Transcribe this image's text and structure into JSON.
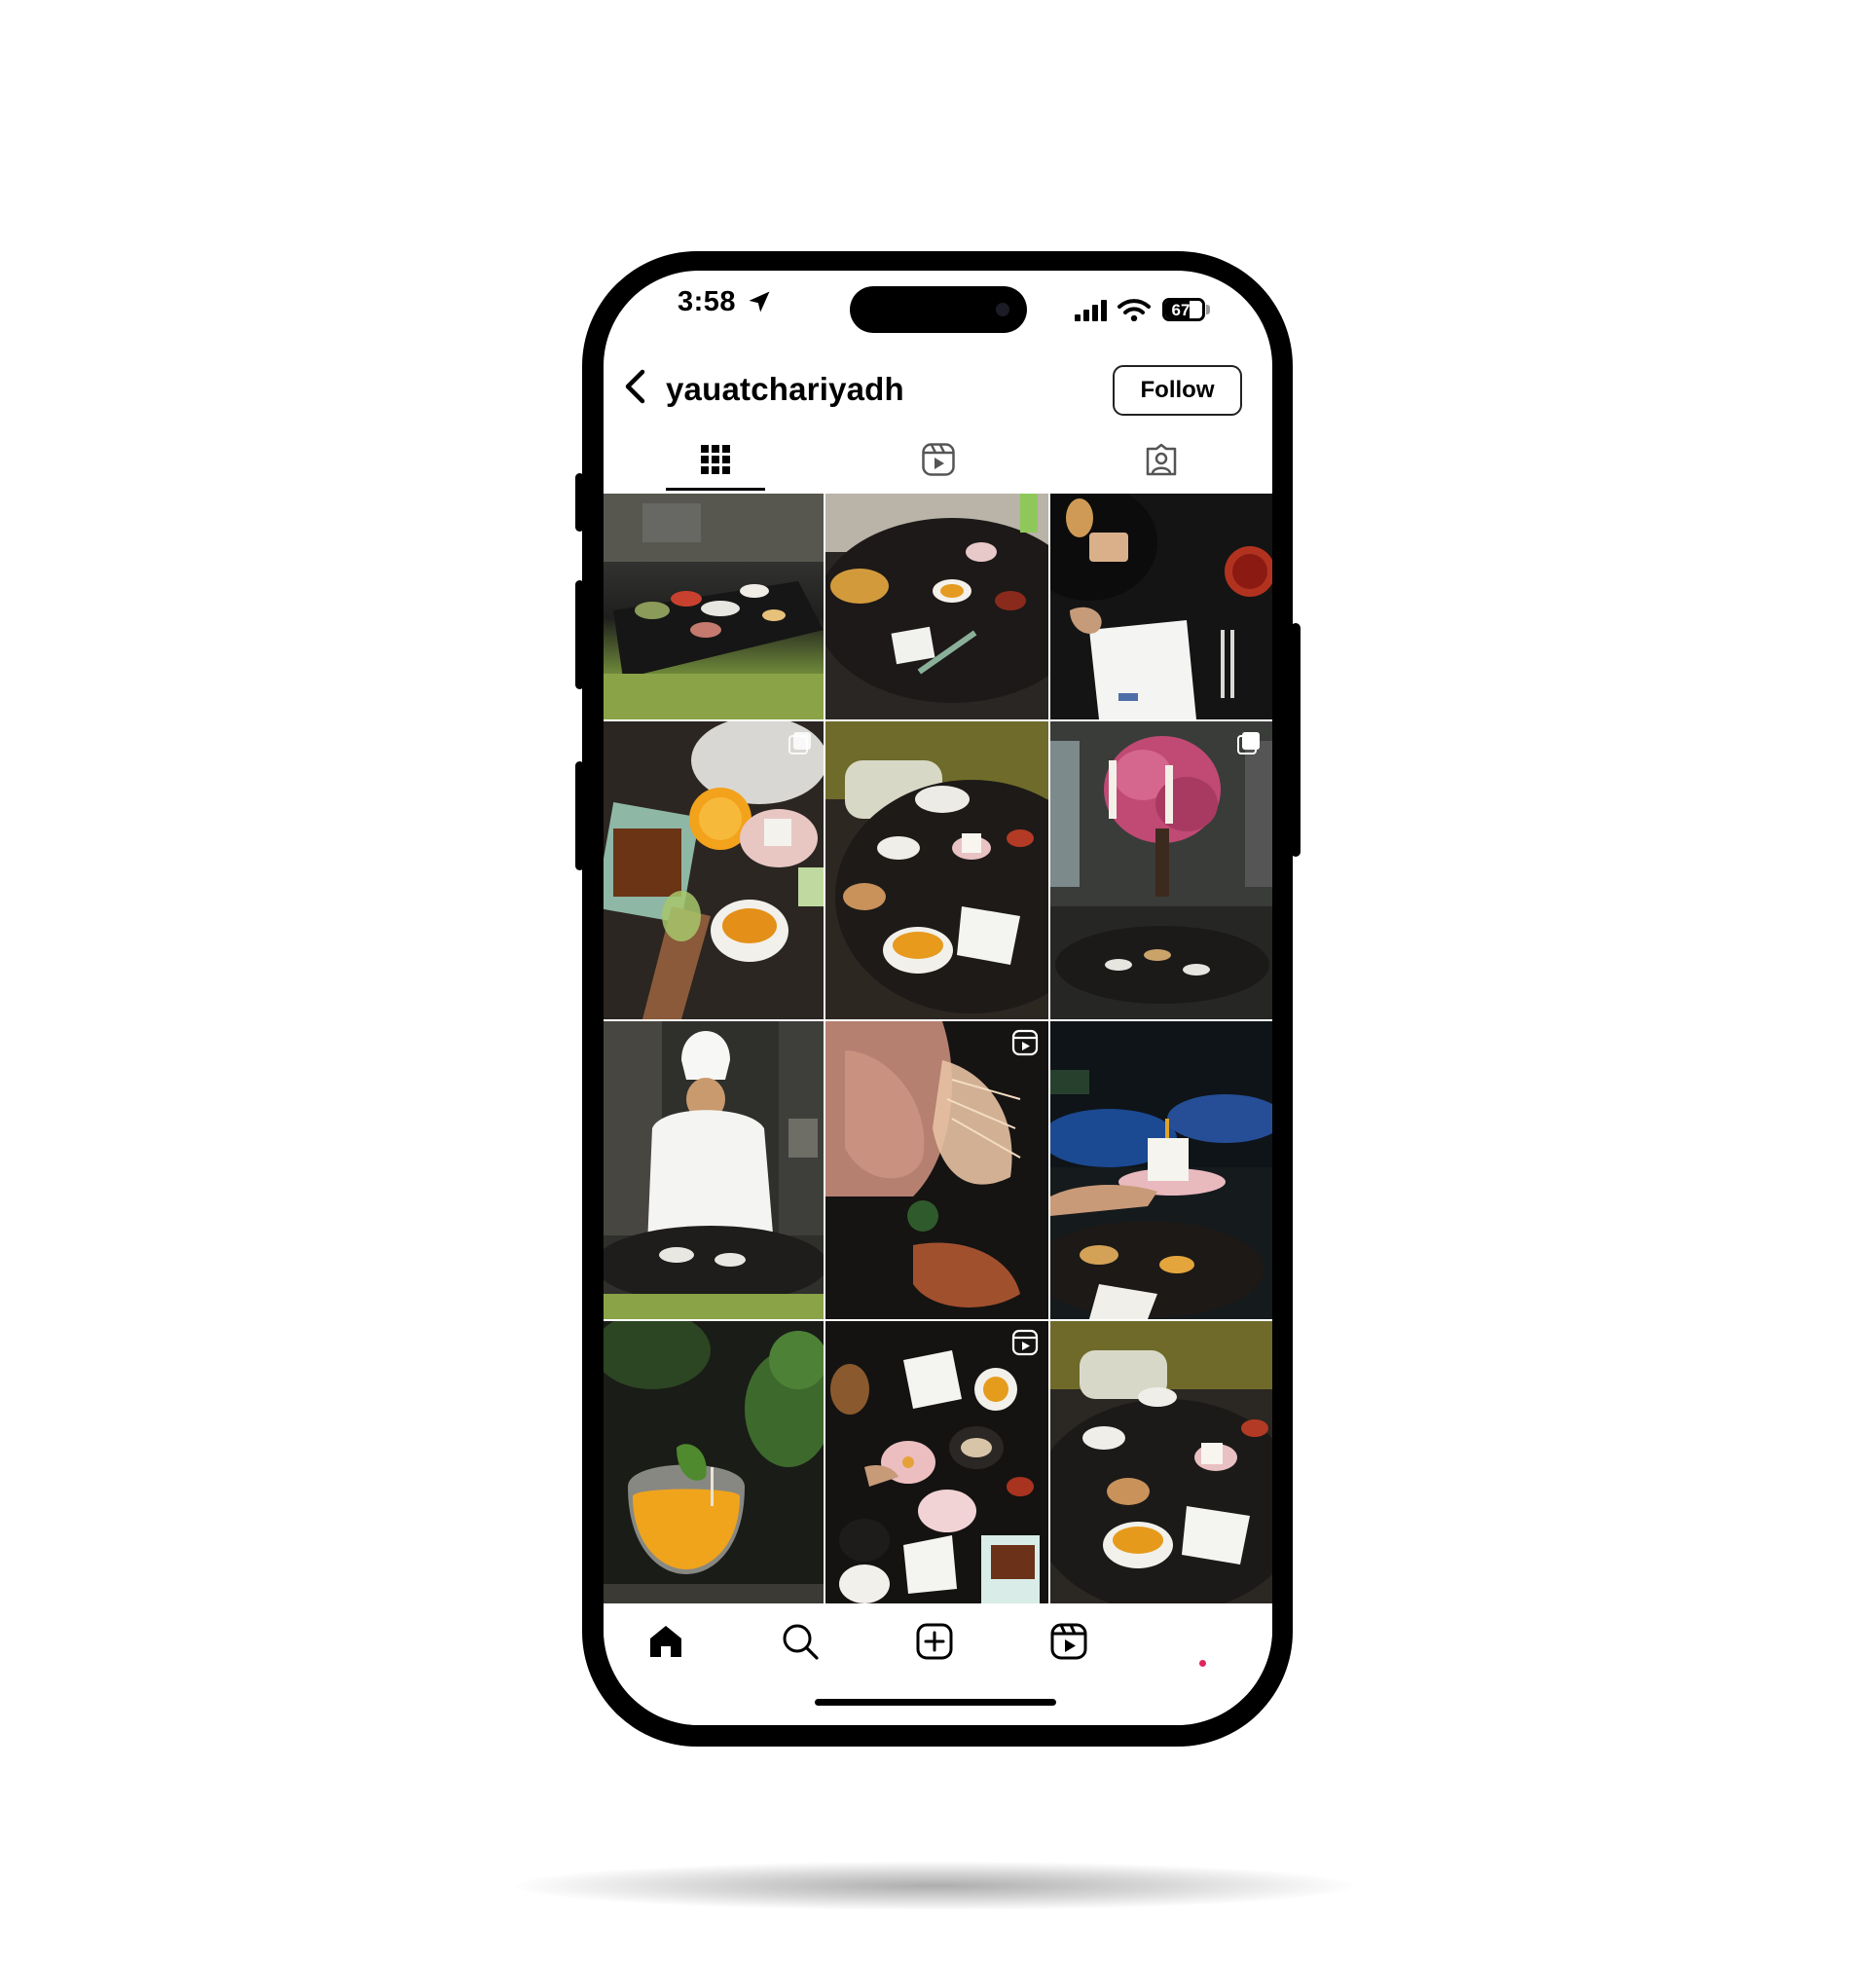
{
  "status_bar": {
    "time": "3:58",
    "battery": "67"
  },
  "profile": {
    "username": "yauatchariyadh",
    "follow_label": "Follow"
  },
  "tabs": [
    {
      "icon": "grid-icon",
      "active": true
    },
    {
      "icon": "reels-icon",
      "active": false
    },
    {
      "icon": "tagged-icon",
      "active": false
    }
  ],
  "grid_posts": [
    {
      "subject": "restaurant table with dishes",
      "badge": "none"
    },
    {
      "subject": "round table with soup and dim sum",
      "badge": "none"
    },
    {
      "subject": "dim sum plate and napkin",
      "badge": "none"
    },
    {
      "subject": "orange drink and dishes",
      "badge": "carousel-icon"
    },
    {
      "subject": "table spread with soups",
      "badge": "none"
    },
    {
      "subject": "cherry blossom tree in dining room",
      "badge": "carousel-icon"
    },
    {
      "subject": "chef plating dishes",
      "badge": "none"
    },
    {
      "subject": "hand holding prawn",
      "badge": "reels-icon"
    },
    {
      "subject": "dessert on pink plate",
      "badge": "none"
    },
    {
      "subject": "orange cocktail with herbs",
      "badge": "none"
    },
    {
      "subject": "overhead table of dishes",
      "badge": "reels-icon"
    },
    {
      "subject": "table with soups and dim sum",
      "badge": "none"
    }
  ],
  "bottom_nav": [
    {
      "icon": "home-icon",
      "active": true
    },
    {
      "icon": "search-icon",
      "active": false
    },
    {
      "icon": "create-icon",
      "active": false
    },
    {
      "icon": "reels-icon",
      "active": false
    },
    {
      "icon": "profile-icon",
      "active": false
    }
  ],
  "colors": {
    "frame": "#000000",
    "screen": "#ffffff",
    "text": "#000000",
    "notification": "#e0245e"
  }
}
